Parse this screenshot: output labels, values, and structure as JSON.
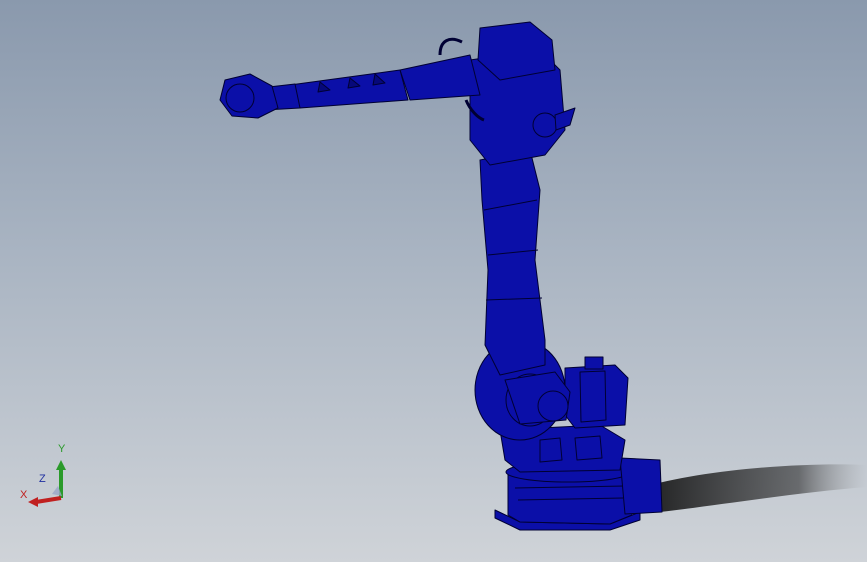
{
  "viewport": {
    "background_top": "#8a99ad",
    "background_bottom": "#cfd3d8",
    "model_color": "#0b0fa8",
    "edge_color": "#000033"
  },
  "triad": {
    "x_label": "X",
    "y_label": "Y",
    "z_label": "Z",
    "x_color": "#c02020",
    "y_color": "#2a9a2a",
    "z_color": "#2030a0"
  }
}
